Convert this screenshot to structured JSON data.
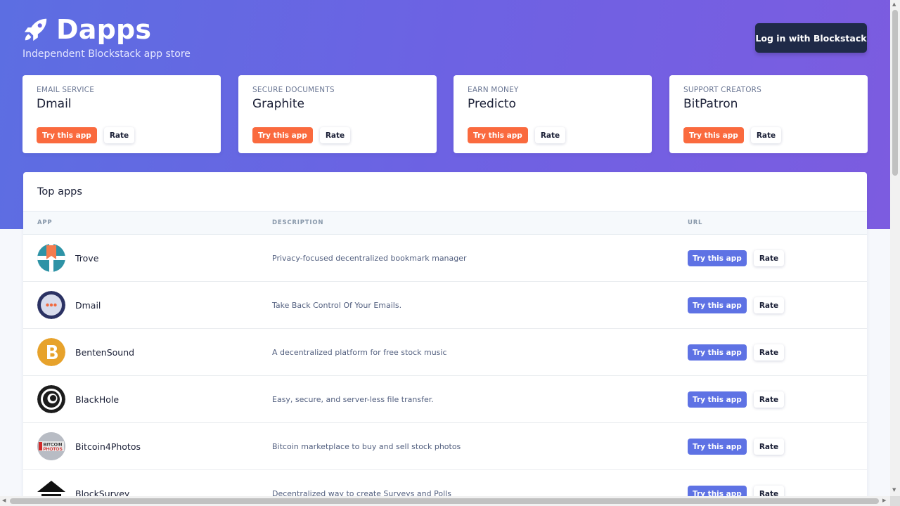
{
  "header": {
    "brand": "Dapps",
    "tagline": "Independent Blockstack app store",
    "login_label": "Log in with Blockstack"
  },
  "featured": [
    {
      "category": "EMAIL SERVICE",
      "name": "Dmail",
      "try_label": "Try this app",
      "rate_label": "Rate"
    },
    {
      "category": "SECURE DOCUMENTS",
      "name": "Graphite",
      "try_label": "Try this app",
      "rate_label": "Rate"
    },
    {
      "category": "EARN MONEY",
      "name": "Predicto",
      "try_label": "Try this app",
      "rate_label": "Rate"
    },
    {
      "category": "SUPPORT CREATORS",
      "name": "BitPatron",
      "try_label": "Try this app",
      "rate_label": "Rate"
    }
  ],
  "top_apps": {
    "title": "Top apps",
    "columns": [
      "APP",
      "DESCRIPTION",
      "URL"
    ],
    "rows": [
      {
        "name": "Trove",
        "description": "Privacy-focused decentralized bookmark manager",
        "logo": "trove-logo",
        "try_label": "Try this app",
        "rate_label": "Rate"
      },
      {
        "name": "Dmail",
        "description": "Take Back Control Of Your Emails.",
        "logo": "dmail-logo",
        "try_label": "Try this app",
        "rate_label": "Rate"
      },
      {
        "name": "BentenSound",
        "description": "A decentralized platform for free stock music",
        "logo": "bentensound-logo",
        "try_label": "Try this app",
        "rate_label": "Rate"
      },
      {
        "name": "BlackHole",
        "description": "Easy, secure, and server-less file transfer.",
        "logo": "blackhole-logo",
        "try_label": "Try this app",
        "rate_label": "Rate"
      },
      {
        "name": "Bitcoin4Photos",
        "description": "Bitcoin marketplace to buy and sell stock photos",
        "logo": "bitcoin4photos-logo",
        "logo_text": "BITCOIN PHOTOS",
        "try_label": "Try this app",
        "rate_label": "Rate"
      },
      {
        "name": "BlockSurvey",
        "description": "Decentralized way to create Surveys and Polls",
        "logo": "blocksurvey-logo",
        "try_label": "Try this app",
        "rate_label": "Rate"
      }
    ]
  },
  "colors": {
    "hero_gradient_start": "#5c6ee2",
    "hero_gradient_end": "#7c5ce0",
    "featured_try": "#fa6a3e",
    "row_try": "#5e72e4",
    "login_button": "#1f2a48"
  }
}
